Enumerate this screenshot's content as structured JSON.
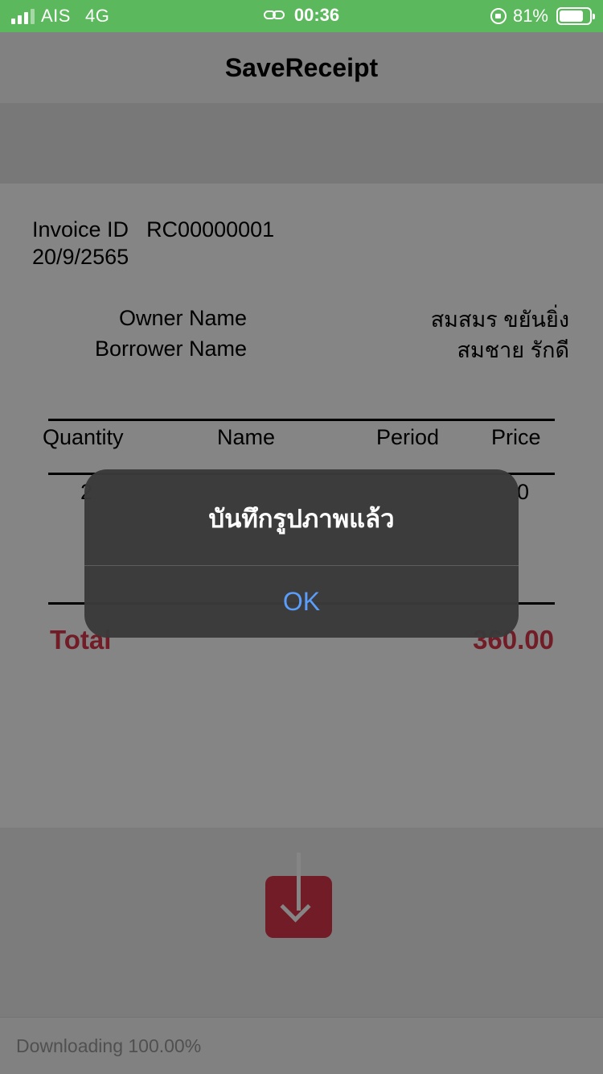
{
  "status_bar": {
    "carrier": "AIS",
    "network": "4G",
    "time": "00:36",
    "battery": "81%",
    "battery_level": 0.81,
    "icons": [
      "signal-icon",
      "link-icon",
      "rotation-lock-icon",
      "battery-icon"
    ]
  },
  "nav": {
    "title": "SaveReceipt"
  },
  "receipt": {
    "invoice_label": "Invoice ID",
    "invoice_id": "RC00000001",
    "date": "20/9/2565",
    "owner_label": "Owner Name",
    "borrower_label": "Borrower Name",
    "owner_name": "สมสมร ขยันยิ่ง",
    "borrower_name": "สมชาย รักดี",
    "columns": [
      "Quantity",
      "Name",
      "Period",
      "Price"
    ],
    "row_visible": {
      "quantity": "2",
      "price": "0"
    },
    "total_label": "Total",
    "total_value": "360.00",
    "accent_color": "#d9374b"
  },
  "download_button": {
    "icon": "download-icon"
  },
  "footer": {
    "status": "Downloading 100.00%"
  },
  "alert": {
    "title": "บันทึกรูปภาพแล้ว",
    "ok_label": "OK",
    "ok_color": "#5b9dfa"
  }
}
